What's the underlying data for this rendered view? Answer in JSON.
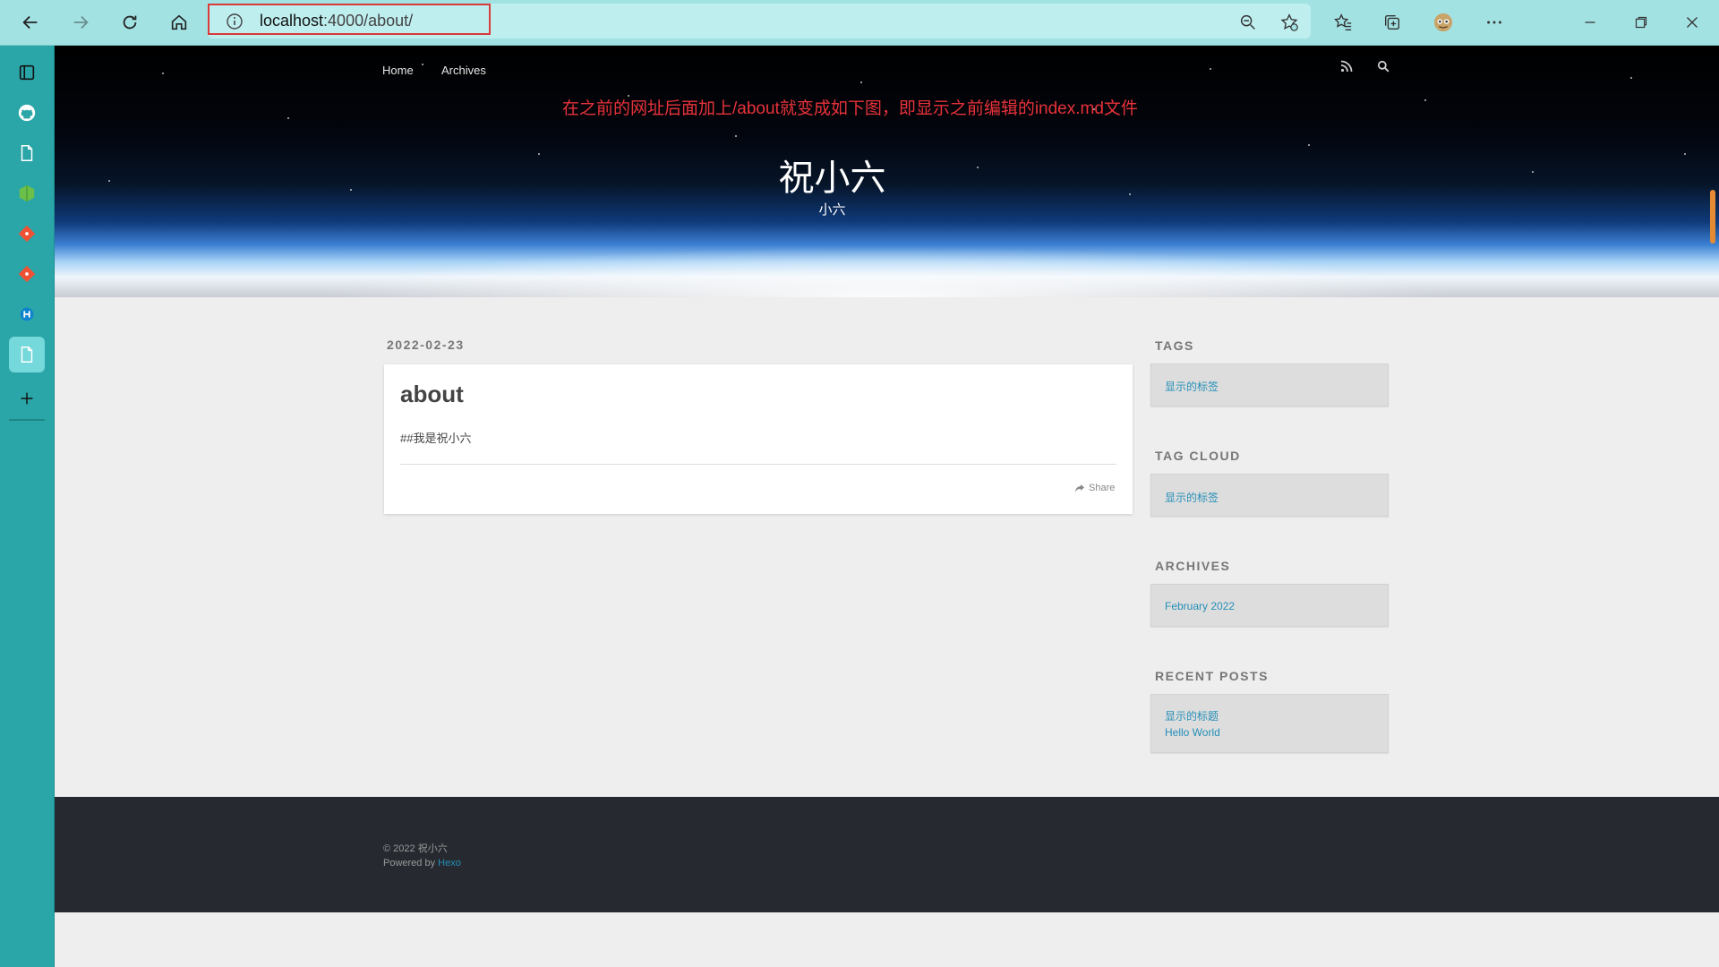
{
  "browser": {
    "address": {
      "host": "localhost",
      "path": ":4000/about/"
    }
  },
  "blog": {
    "nav": {
      "home": "Home",
      "archives": "Archives"
    },
    "annotation": "在之前的网址后面加上/about就变成如下图，即显示之前编辑的index.md文件",
    "title": "祝小六",
    "subtitle": "小六",
    "post": {
      "date": "2022-02-23",
      "title": "about",
      "body": "##我是祝小六",
      "share": "Share"
    },
    "widgets": {
      "tags": {
        "heading": "TAGS",
        "items": [
          "显示的标签"
        ]
      },
      "tag_cloud": {
        "heading": "TAG CLOUD",
        "items": [
          "显示的标签"
        ]
      },
      "archives": {
        "heading": "ARCHIVES",
        "items": [
          "February 2022"
        ]
      },
      "recent_posts": {
        "heading": "RECENT POSTS",
        "items": [
          "显示的标题",
          "Hello World"
        ]
      }
    },
    "footer": {
      "copyright": "© 2022 祝小六",
      "powered_prefix": "Powered by ",
      "powered_link": "Hexo"
    }
  },
  "colors": {
    "chrome": "#a3e2e3",
    "sidebar": "#2ba6a8",
    "annotation": "#e8323a",
    "link": "#258fb8",
    "footer": "#262a30"
  }
}
